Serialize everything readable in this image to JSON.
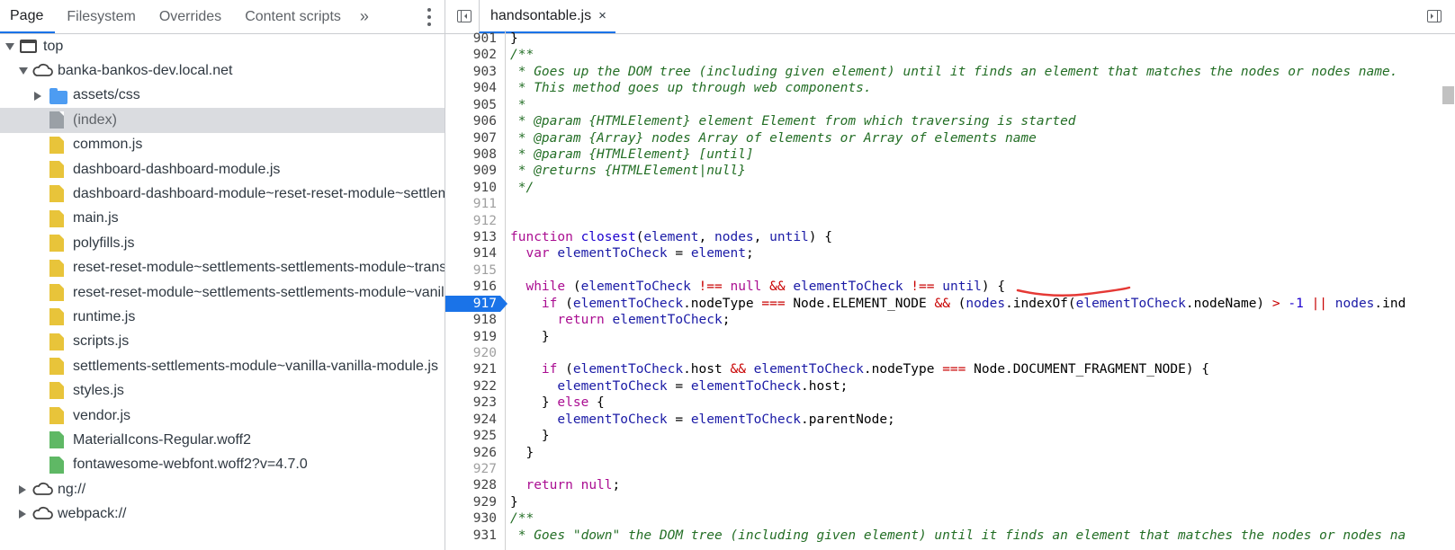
{
  "navigator": {
    "tabs": [
      "Page",
      "Filesystem",
      "Overrides",
      "Content scripts"
    ],
    "more_tabs_glyph": "»",
    "tree": {
      "top": "top",
      "domain": "banka-bankos-dev.local.net",
      "folder": "assets/css",
      "files": [
        {
          "name": "(index)",
          "type": "html",
          "selected": true
        },
        {
          "name": "common.js",
          "type": "js"
        },
        {
          "name": "dashboard-dashboard-module.js",
          "type": "js"
        },
        {
          "name": "dashboard-dashboard-module~reset-reset-module~settlements-settlements-module",
          "type": "js"
        },
        {
          "name": "main.js",
          "type": "js"
        },
        {
          "name": "polyfills.js",
          "type": "js"
        },
        {
          "name": "reset-reset-module~settlements-settlements-module~transactions",
          "type": "js"
        },
        {
          "name": "reset-reset-module~settlements-settlements-module~vanilla",
          "type": "js"
        },
        {
          "name": "runtime.js",
          "type": "js"
        },
        {
          "name": "scripts.js",
          "type": "js"
        },
        {
          "name": "settlements-settlements-module~vanilla-vanilla-module.js",
          "type": "js"
        },
        {
          "name": "styles.js",
          "type": "js"
        },
        {
          "name": "vendor.js",
          "type": "js"
        },
        {
          "name": "MaterialIcons-Regular.woff2",
          "type": "font"
        },
        {
          "name": "fontawesome-webfont.woff2?v=4.7.0",
          "type": "font"
        }
      ],
      "other_domains": [
        "ng://",
        "webpack://"
      ]
    }
  },
  "editor": {
    "file_tab": "handsontable.js",
    "close_glyph": "×",
    "breakpoint_line": 917,
    "lines": [
      {
        "n": "901",
        "html": "<span class=\"p\">}</span>"
      },
      {
        "n": "902",
        "html": "<span class=\"c\">/**</span>"
      },
      {
        "n": "903",
        "html": "<span class=\"c\"> * Goes up the DOM tree (including given element) until it finds an element that matches the nodes or nodes name.</span>"
      },
      {
        "n": "904",
        "html": "<span class=\"c\"> * This method goes up through web components.</span>"
      },
      {
        "n": "905",
        "html": "<span class=\"c\"> *</span>"
      },
      {
        "n": "906",
        "html": "<span class=\"c\"> * @param {HTMLElement} element Element from which traversing is started</span>"
      },
      {
        "n": "907",
        "html": "<span class=\"c\"> * @param {Array} nodes Array of elements or Array of elements name</span>"
      },
      {
        "n": "908",
        "html": "<span class=\"c\"> * @param {HTMLElement} [until]</span>"
      },
      {
        "n": "909",
        "html": "<span class=\"c\"> * @returns {HTMLElement|null}</span>"
      },
      {
        "n": "910",
        "html": "<span class=\"c\"> */</span>"
      },
      {
        "n": "911",
        "html": "",
        "blank": true
      },
      {
        "n": "912",
        "html": "",
        "blank": true
      },
      {
        "n": "913",
        "html": "<span class=\"k\">function</span> <span class=\"f\">closest</span>(<span class=\"v\">element</span>, <span class=\"v\">nodes</span>, <span class=\"v\">until</span>) {"
      },
      {
        "n": "914",
        "html": "  <span class=\"k\">var</span> <span class=\"v\">elementToCheck</span> = <span class=\"v\">element</span>;"
      },
      {
        "n": "915",
        "html": "",
        "blank": true
      },
      {
        "n": "916",
        "html": "  <span class=\"k\">while</span> (<span class=\"v\">elementToCheck</span> <span class=\"o\">!==</span> <span class=\"k\">null</span> <span class=\"o\">&amp;&amp;</span> <span class=\"v\">elementToCheck</span> <span class=\"o\">!==</span> <span class=\"v\">until</span>) {"
      },
      {
        "n": "917",
        "html": "    <span class=\"k\">if</span> (<span class=\"v\">elementToCheck</span>.nodeType <span class=\"o\">===</span> Node.ELEMENT_NODE <span class=\"o\">&amp;&amp;</span> (<span class=\"v\">nodes</span>.indexOf(<span class=\"v\">elementToCheck</span>.nodeName) <span class=\"o\">&gt;</span> <span class=\"n\">-1</span> <span class=\"o\">||</span> <span class=\"v\">nodes</span>.ind"
      },
      {
        "n": "918",
        "html": "      <span class=\"k\">return</span> <span class=\"v\">elementToCheck</span>;"
      },
      {
        "n": "919",
        "html": "    }"
      },
      {
        "n": "920",
        "html": "",
        "blank": true
      },
      {
        "n": "921",
        "html": "    <span class=\"k\">if</span> (<span class=\"v\">elementToCheck</span>.host <span class=\"o\">&amp;&amp;</span> <span class=\"v\">elementToCheck</span>.nodeType <span class=\"o\">===</span> Node.DOCUMENT_FRAGMENT_NODE) {"
      },
      {
        "n": "922",
        "html": "      <span class=\"v\">elementToCheck</span> = <span class=\"v\">elementToCheck</span>.host;"
      },
      {
        "n": "923",
        "html": "    } <span class=\"k\">else</span> {"
      },
      {
        "n": "924",
        "html": "      <span class=\"v\">elementToCheck</span> = <span class=\"v\">elementToCheck</span>.parentNode;"
      },
      {
        "n": "925",
        "html": "    }"
      },
      {
        "n": "926",
        "html": "  }"
      },
      {
        "n": "927",
        "html": "",
        "blank": true
      },
      {
        "n": "928",
        "html": "  <span class=\"k\">return</span> <span class=\"k\">null</span>;"
      },
      {
        "n": "929",
        "html": "}"
      },
      {
        "n": "930",
        "html": "<span class=\"c\">/**</span>"
      },
      {
        "n": "931",
        "html": "<span class=\"c\"> * Goes \"down\" the DOM tree (including given element) until it finds an element that matches the nodes or nodes na</span>"
      }
    ]
  },
  "colors": {
    "accent": "#1a73e8",
    "annotation": "#e53935",
    "selection": "#dadce0"
  }
}
